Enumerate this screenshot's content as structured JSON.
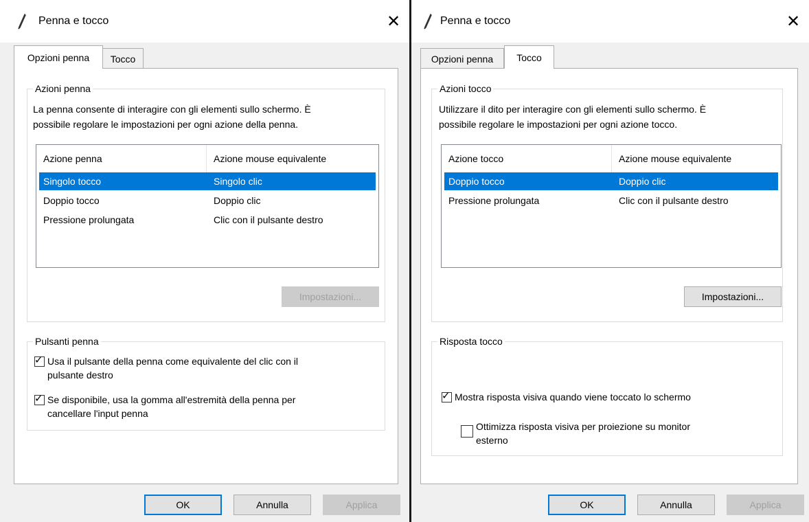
{
  "left": {
    "title": "Penna e tocco",
    "tabs": [
      {
        "label": "Opzioni penna"
      },
      {
        "label": "Tocco"
      }
    ],
    "actions_group": {
      "label": "Azioni penna",
      "description_line1": "La penna consente di interagire con gli elementi sullo schermo. È",
      "description_line2": "possibile regolare le impostazioni per ogni azione della penna."
    },
    "list": {
      "columns": [
        "Azione penna",
        "Azione mouse equivalente"
      ],
      "rows": [
        {
          "action": "Singolo tocco",
          "mouse": "Singolo clic",
          "selected": true
        },
        {
          "action": "Doppio tocco",
          "mouse": "Doppio clic",
          "selected": false
        },
        {
          "action": "Pressione prolungata",
          "mouse": "Clic con il pulsante destro",
          "selected": false
        }
      ]
    },
    "settings_button": "Impostazioni...",
    "buttons_group": {
      "label": "Pulsanti penna",
      "check1_line1": "Usa il pulsante della penna come equivalente del clic con il",
      "check1_line2": "pulsante destro",
      "check1_checked": true,
      "check2_line1": "Se disponibile, usa la gomma all'estremità della penna per",
      "check2_line2": "cancellare l'input penna",
      "check2_checked": true
    },
    "footer": {
      "ok": "OK",
      "cancel": "Annulla",
      "apply": "Applica"
    }
  },
  "right": {
    "title": "Penna e tocco",
    "tabs": [
      {
        "label": "Opzioni penna"
      },
      {
        "label": "Tocco"
      }
    ],
    "actions_group": {
      "label": "Azioni tocco",
      "description_line1": "Utilizzare il dito per interagire con gli elementi sullo schermo. È",
      "description_line2": "possibile regolare le impostazioni per ogni azione tocco."
    },
    "list": {
      "columns": [
        "Azione tocco",
        "Azione mouse equivalente"
      ],
      "rows": [
        {
          "action": "Doppio tocco",
          "mouse": "Doppio clic",
          "selected": true
        },
        {
          "action": "Pressione prolungata",
          "mouse": "Clic con il pulsante destro",
          "selected": false
        }
      ]
    },
    "settings_button": "Impostazioni...",
    "feedback_group": {
      "label": "Risposta tocco",
      "check1": "Mostra risposta visiva quando viene toccato lo schermo",
      "check1_checked": true,
      "check2_line1": "Ottimizza risposta visiva per proiezione su monitor",
      "check2_line2": "esterno",
      "check2_checked": false
    },
    "footer": {
      "ok": "OK",
      "cancel": "Annulla",
      "apply": "Applica"
    }
  },
  "icons": {
    "title": "pen-icon",
    "close": "close-icon",
    "check": "checkmark-icon"
  },
  "colors": {
    "selection": "#0078d7",
    "dialog_bg": "#f0f0f0",
    "panel_bg": "#ffffff"
  }
}
